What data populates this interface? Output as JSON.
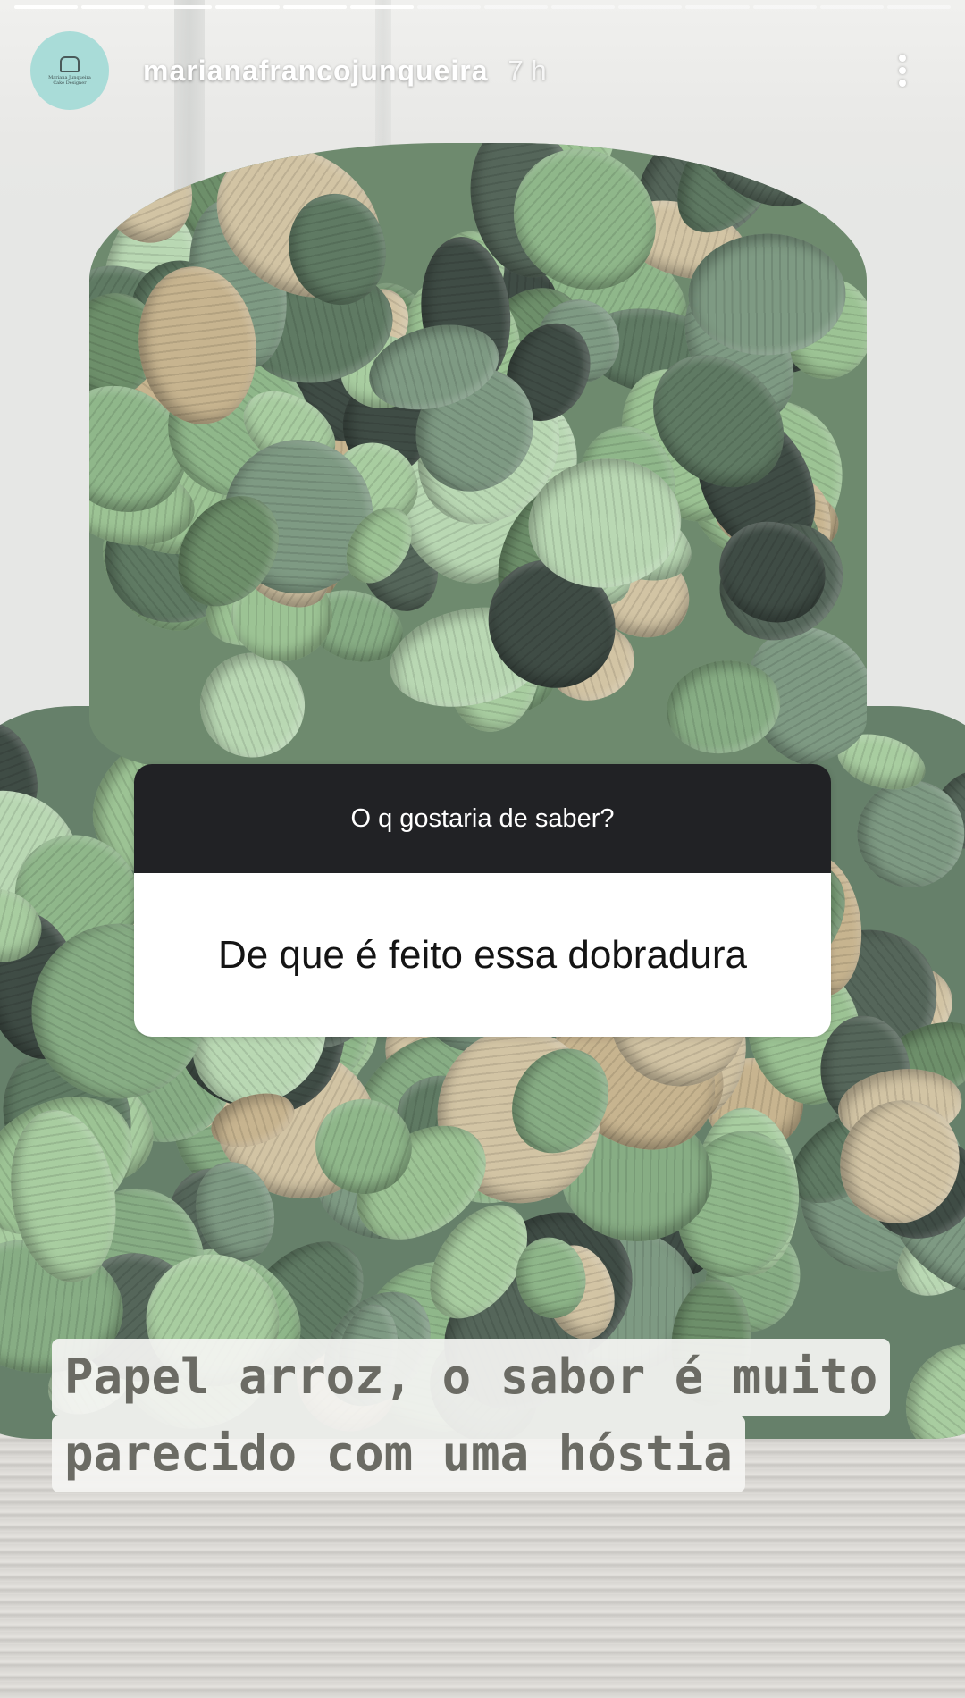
{
  "story": {
    "progress_total": 14,
    "progress_current": 6
  },
  "header": {
    "username": "marianafrancojunqueira",
    "time": "7 h",
    "avatar_text_line1": "Mariana Junqueira",
    "avatar_text_line2": "Cake Designer"
  },
  "question_sticker": {
    "prompt": "O q gostaria de saber?",
    "question": "De que é feito essa dobradura"
  },
  "answer": {
    "line1": "Papel arroz, o sabor é muito",
    "line2": "parecido com uma hóstia"
  },
  "colors": {
    "avatar_bg": "#a9dcd8",
    "sticker_header": "#212225",
    "answer_text": "#6b6b64"
  },
  "icons": [
    "more-options-icon"
  ]
}
